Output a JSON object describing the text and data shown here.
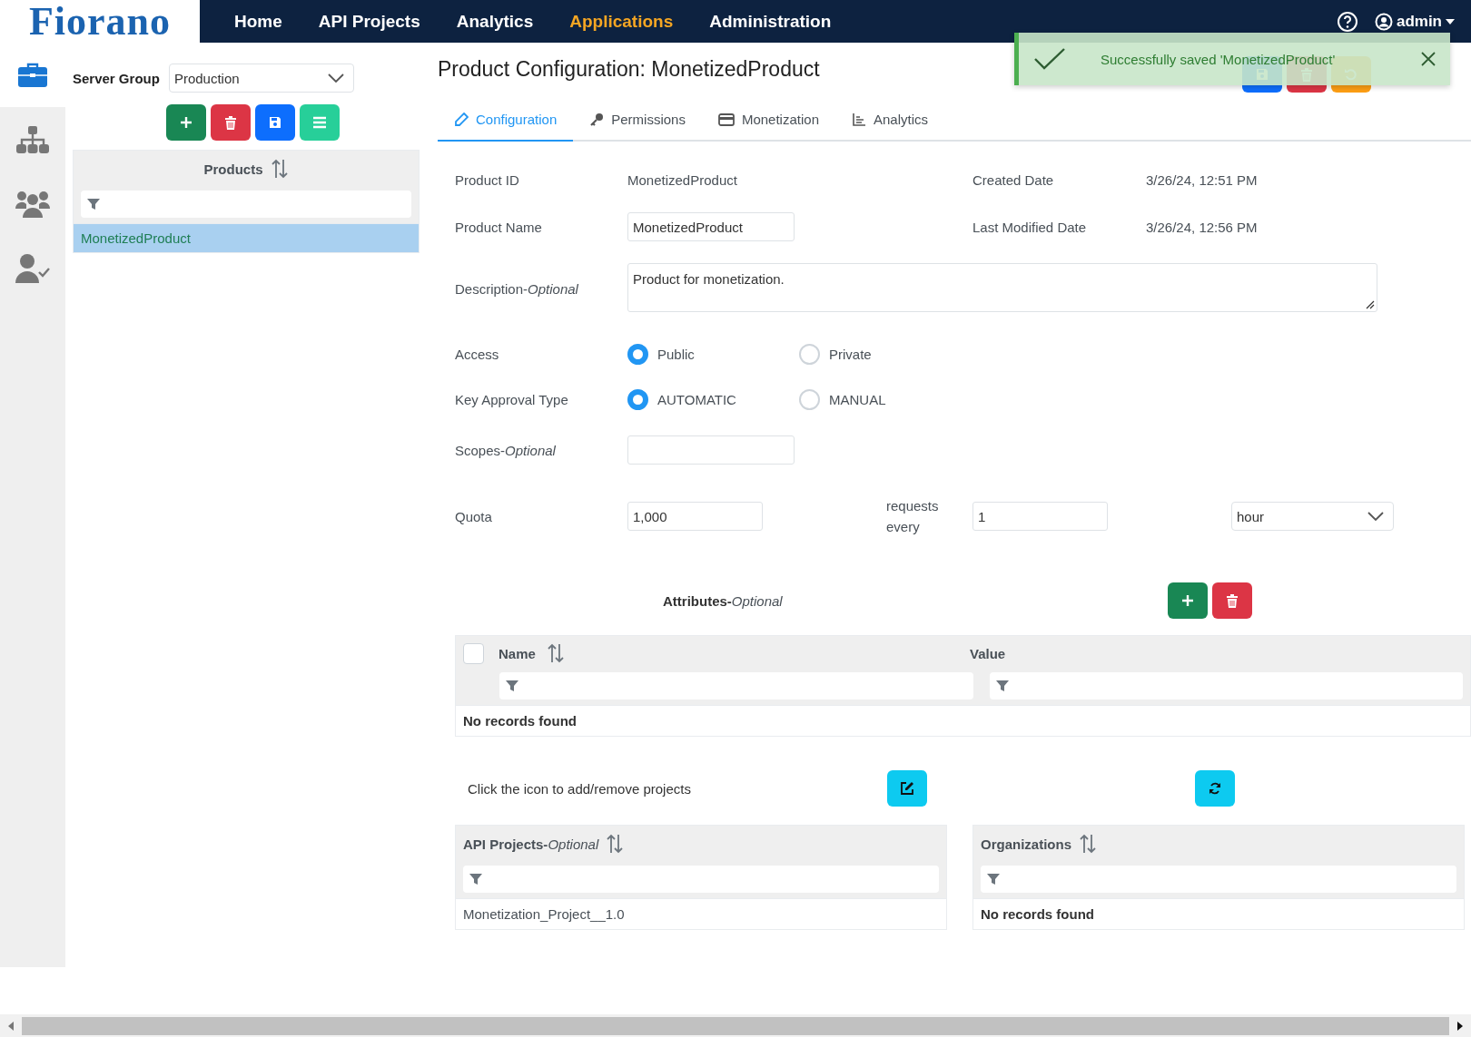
{
  "logo": {
    "text": "Fiorano"
  },
  "nav": {
    "items": [
      {
        "label": "Home",
        "selected": false
      },
      {
        "label": "API Projects",
        "selected": false
      },
      {
        "label": "Analytics",
        "selected": false
      },
      {
        "label": "Applications",
        "selected": true
      },
      {
        "label": "Administration",
        "selected": false
      }
    ],
    "user": "admin"
  },
  "sidebar": {
    "items": [
      {
        "kind": "briefcase",
        "selected": true
      },
      {
        "kind": "sitemap",
        "selected": false
      },
      {
        "kind": "users",
        "selected": false
      },
      {
        "kind": "user-check",
        "selected": false
      }
    ]
  },
  "left_panel": {
    "server_group": {
      "label": "Server Group",
      "value": "Production"
    },
    "buttons": [
      {
        "kind": "add"
      },
      {
        "kind": "delete"
      },
      {
        "kind": "save"
      },
      {
        "kind": "list"
      }
    ],
    "products": {
      "column": "Products",
      "rows": [
        {
          "name": "MonetizedProduct",
          "selected": true
        }
      ]
    }
  },
  "page": {
    "title": "Product Configuration: MonetizedProduct",
    "buttons": [
      {
        "kind": "save"
      },
      {
        "kind": "delete"
      },
      {
        "kind": "undo"
      }
    ],
    "tabs": [
      {
        "label": "Configuration",
        "kind": "pencil",
        "selected": true
      },
      {
        "label": "Permissions",
        "kind": "key",
        "selected": false
      },
      {
        "label": "Monetization",
        "kind": "card",
        "selected": false
      },
      {
        "label": "Analytics",
        "kind": "chart",
        "selected": false
      }
    ]
  },
  "form": {
    "product_id": {
      "label": "Product ID",
      "value": "MonetizedProduct"
    },
    "created_date": {
      "label": "Created Date",
      "value": "3/26/24, 12:51 PM"
    },
    "product_name": {
      "label": "Product Name",
      "value": "MonetizedProduct"
    },
    "last_modified_date": {
      "label": "Last Modified Date",
      "value": "3/26/24, 12:56 PM"
    },
    "description": {
      "label": "Description-*Optional*",
      "value": "Product for monetization."
    },
    "access": {
      "label": "Access",
      "options": [
        {
          "label": "Public",
          "selected": true
        },
        {
          "label": "Private",
          "selected": false
        }
      ]
    },
    "key_approval_type": {
      "label": "Key Approval Type",
      "options": [
        {
          "label": "AUTOMATIC",
          "selected": true
        },
        {
          "label": "MANUAL",
          "selected": false
        }
      ]
    },
    "scopes": {
      "label": "Scopes-*Optional*"
    },
    "quota": {
      "label": "Quota",
      "value": "1,000",
      "per_label": "requests every",
      "interval": "1",
      "unit": "hour"
    }
  },
  "attributes": {
    "label": "Attributes-*Optional*",
    "buttons": [
      {
        "kind": "add"
      },
      {
        "kind": "delete"
      }
    ],
    "select_all": {
      "checked": false
    },
    "columns": [
      {
        "label": "Name",
        "sortable": true
      },
      {
        "label": "Value",
        "sortable": false
      }
    ],
    "empty": "No records found"
  },
  "projects": {
    "note": "Click the icon to add/remove projects",
    "buttons": [
      {
        "kind": "edit"
      },
      {
        "kind": "refresh"
      }
    ],
    "api_projects": {
      "column": "API Projects-*Optional*",
      "rows": [
        "Monetization_Project__1.0"
      ]
    },
    "organizations": {
      "column": "Organizations",
      "empty": "No records found"
    }
  },
  "toast": {
    "message": "Successfully saved 'MonetizedProduct'"
  }
}
